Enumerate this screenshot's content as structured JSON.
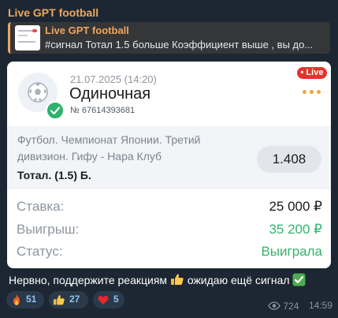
{
  "channel": {
    "name": "Live GPT football"
  },
  "reply": {
    "title": "Live GPT football",
    "text": "#сигнал   Тотал 1.5 больше   Коэффициент выше , вы до..."
  },
  "bet_card": {
    "date": "21.07.2025 (14:20)",
    "type": "Одиночная",
    "number": "№ 67614393681",
    "live_badge": "Live",
    "event_lines": [
      "Футбол. Чемпионат Японии. Третий",
      "дивизион. Гифу - Нара Клуб"
    ],
    "market": "Тотал. (1.5) Б.",
    "coefficient": "1.408",
    "summary": [
      {
        "label": "Ставка:",
        "value": "25 000 ₽",
        "tone": "dark"
      },
      {
        "label": "Выигрыш:",
        "value": "35 200 ₽",
        "tone": "green"
      },
      {
        "label": "Статус:",
        "value": "Выиграла",
        "tone": "green"
      }
    ]
  },
  "message": {
    "text_before": "Нервно, поддержите реакциям",
    "text_middle": "ожидаю ещё сигнал"
  },
  "reactions": [
    {
      "icon": "fire-icon",
      "count": "51"
    },
    {
      "icon": "thumbs-up-icon",
      "count": "27"
    },
    {
      "icon": "heart-icon",
      "count": "5"
    }
  ],
  "footer": {
    "views": "724",
    "time": "14:59"
  },
  "colors": {
    "accent": "#f0a65e",
    "green": "#33b36b",
    "live": "#e5322d"
  }
}
